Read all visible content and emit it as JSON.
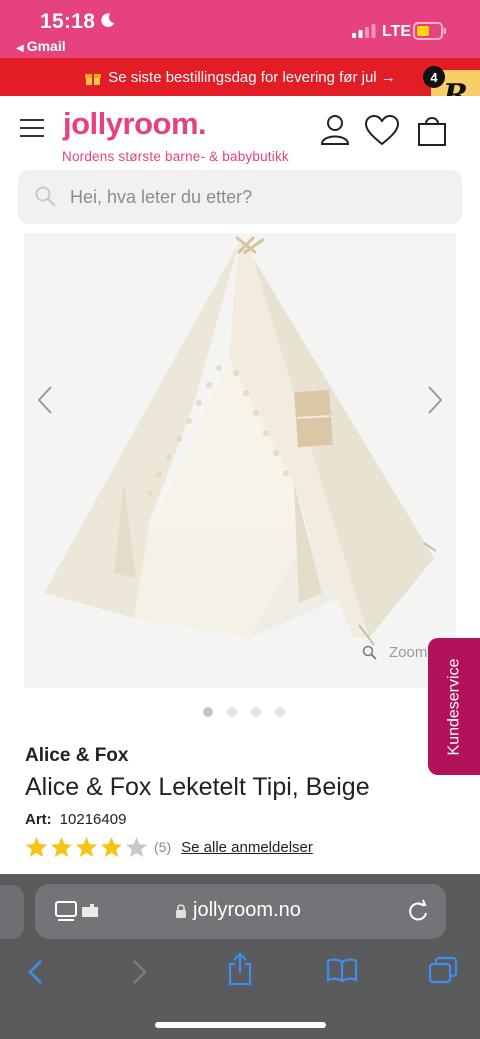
{
  "status_bar": {
    "time": "15:18",
    "back_app": "Gmail",
    "network": "LTE"
  },
  "promo": {
    "text": "Se siste bestillingsdag for levering før jul →"
  },
  "reward": {
    "count": "4",
    "letter": "R"
  },
  "header": {
    "logo": "jollyroom.",
    "tagline": "Nordens største barne- & babybutikk"
  },
  "search": {
    "placeholder": "Hei, hva leter du etter?"
  },
  "gallery": {
    "zoom_label": "Zoom",
    "image_count": 4,
    "active_index": 0
  },
  "side_tab": {
    "label": "Kundeservice"
  },
  "product": {
    "brand": "Alice & Fox",
    "title": "Alice & Fox Leketelt Tipi, Beige",
    "art_label": "Art:",
    "art_number": "10216409",
    "rating_stars": 4,
    "rating_count": "(5)",
    "reviews_link": "Se alle anmeldelser"
  },
  "browser": {
    "url": "jollyroom.no"
  },
  "colors": {
    "brand_pink": "#e5427e",
    "promo_red": "#e21d25",
    "kundeservice": "#b2125a",
    "star": "#f6c414",
    "safari_blue": "#3d8ef0"
  }
}
